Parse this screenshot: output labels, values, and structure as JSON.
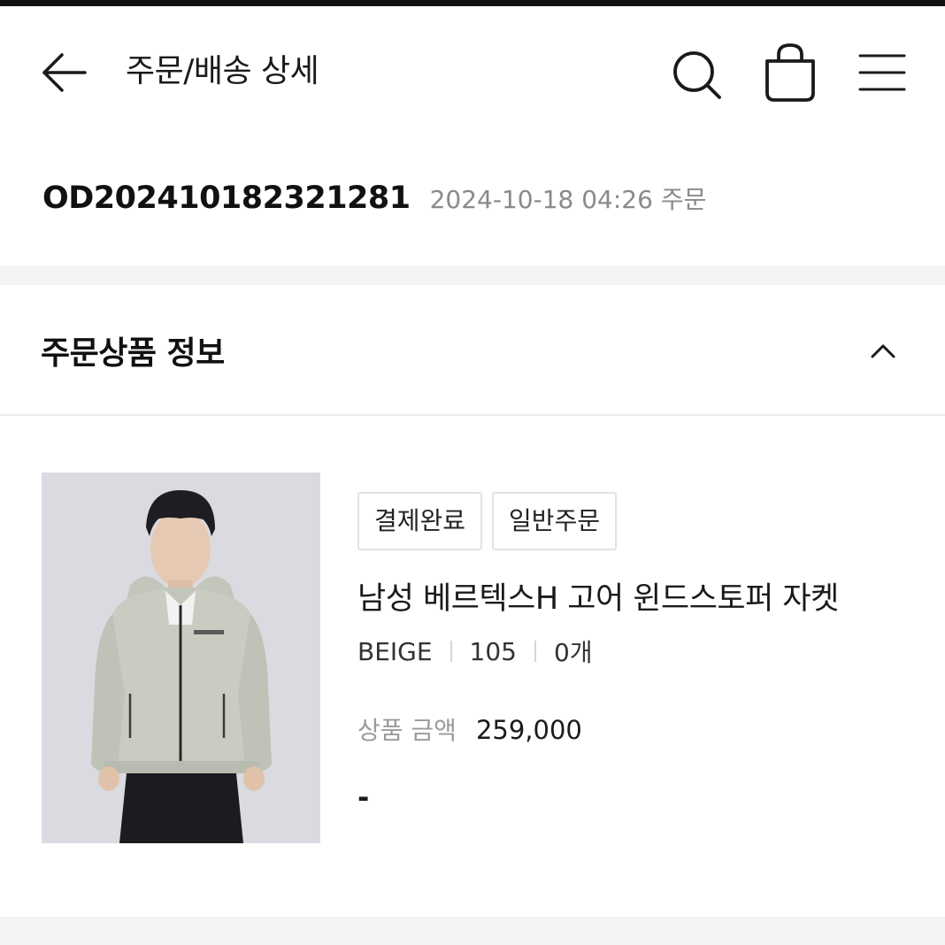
{
  "header": {
    "title": "주문/배송 상세",
    "back_icon": "arrow-left-icon",
    "search_icon": "search-icon",
    "bag_icon": "shopping-bag-icon",
    "menu_icon": "hamburger-menu-icon"
  },
  "order": {
    "number": "OD20241018232128​1",
    "datetime_label": "2024-10-18 04:26 주문"
  },
  "section": {
    "title": "주문상품 정보",
    "toggle_icon": "chevron-up-icon"
  },
  "product": {
    "badges": [
      "결제완료",
      "일반주문"
    ],
    "name": "남성 베르텍스H 고어 윈드스토퍼 자켓",
    "options": [
      "BEIGE",
      "105",
      "0개"
    ],
    "price_label": "상품 금액",
    "price_value": "259,000",
    "extra": "-",
    "image_icon": "product-photo-jacket"
  },
  "colors": {
    "accent_text": "#1a1a1a",
    "muted_text": "#8a8a8a",
    "divider": "#f4f4f4",
    "image_bg": "#d9dbe0",
    "jacket": "#c9ccc0"
  }
}
